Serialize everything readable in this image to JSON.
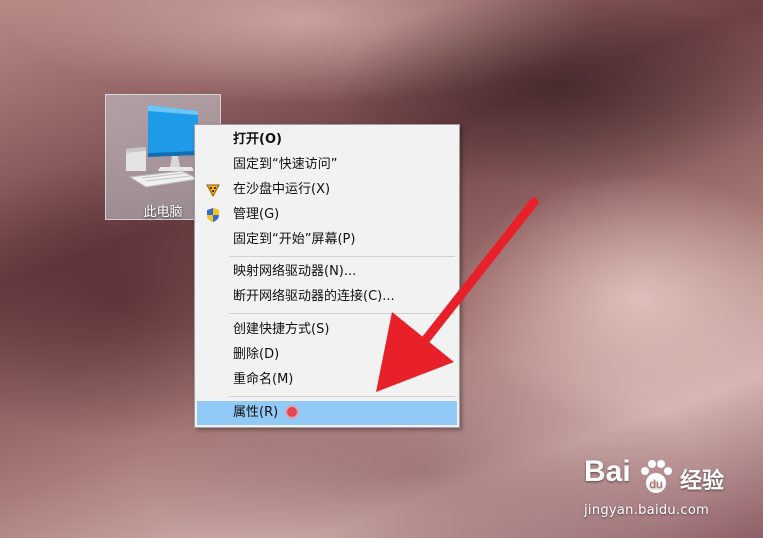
{
  "desktop": {
    "icon_label": "此电脑"
  },
  "context_menu": {
    "items": [
      {
        "label": "打开(O)",
        "bold": true
      },
      {
        "label": "固定到“快速访问”"
      },
      {
        "label": "在沙盘中运行(X)",
        "icon": "sandbox-icon"
      },
      {
        "label": "管理(G)",
        "icon": "uac-shield-icon"
      },
      {
        "label": "固定到“开始”屏幕(P)"
      },
      {
        "label": "映射网络驱动器(N)..."
      },
      {
        "label": "断开网络驱动器的连接(C)..."
      },
      {
        "label": "创建快捷方式(S)"
      },
      {
        "label": "删除(D)"
      },
      {
        "label": "重命名(M)"
      },
      {
        "label": "属性(R)",
        "highlighted": true
      }
    ]
  },
  "annotation": {
    "arrow_color": "#e8202a"
  },
  "watermark": {
    "logo": "Bai",
    "logo2": "经验",
    "url": "jingyan.baidu.com"
  }
}
